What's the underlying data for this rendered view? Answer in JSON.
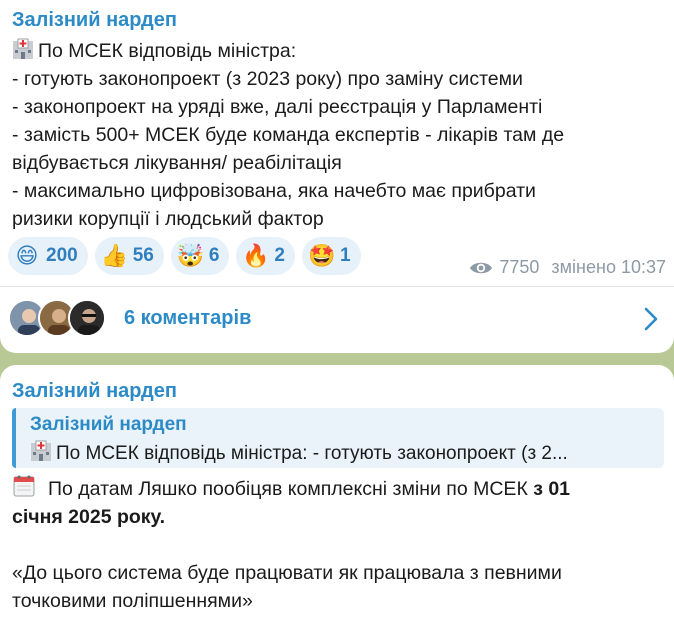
{
  "post": {
    "channel_name": "Залізний нардеп",
    "lines": [
      "По МСЕК відповідь міністра:",
      "- готують законопроект (з 2023 року) про заміну системи",
      "- законопроект на уряді вже,  далі реєстрація у Парламенті",
      "- замість 500+ МСЕК буде команда експертів - лікарів там де",
      "відбувається лікування/ реабілітація",
      "- максимально цифровізована, яка начебто має прибрати",
      "ризики корупції і людський фактор"
    ],
    "reactions": [
      {
        "emoji": "😄",
        "count": "200"
      },
      {
        "emoji": "👍",
        "count": "56"
      },
      {
        "emoji": "🤯",
        "count": "6"
      },
      {
        "emoji": "🔥",
        "count": "2"
      },
      {
        "emoji": "🤩",
        "count": "1"
      }
    ],
    "views": "7750",
    "edited_time": "змінено 10:37",
    "comments_label": "6 коментарів"
  },
  "reply": {
    "channel_name": "Залізний нардеп",
    "quote_name": "Залізний нардеп",
    "quote_text": "По МСЕК відповідь міністра: - готують законопроект (з 2...",
    "line1_regular": "По датам Ляшко пообіцяв комплексні зміни по МСЕК ",
    "line1_bold": "з 01",
    "line2_bold": "січня 2025 року.",
    "quote_line1": "«До цього система буде працювати як працювала з певними",
    "quote_line2": "точковими поліпшеннями»"
  },
  "colors": {
    "accent": "#2c8bc6",
    "reaction_bg": "#e7f1fa",
    "background": "#b9c995"
  }
}
